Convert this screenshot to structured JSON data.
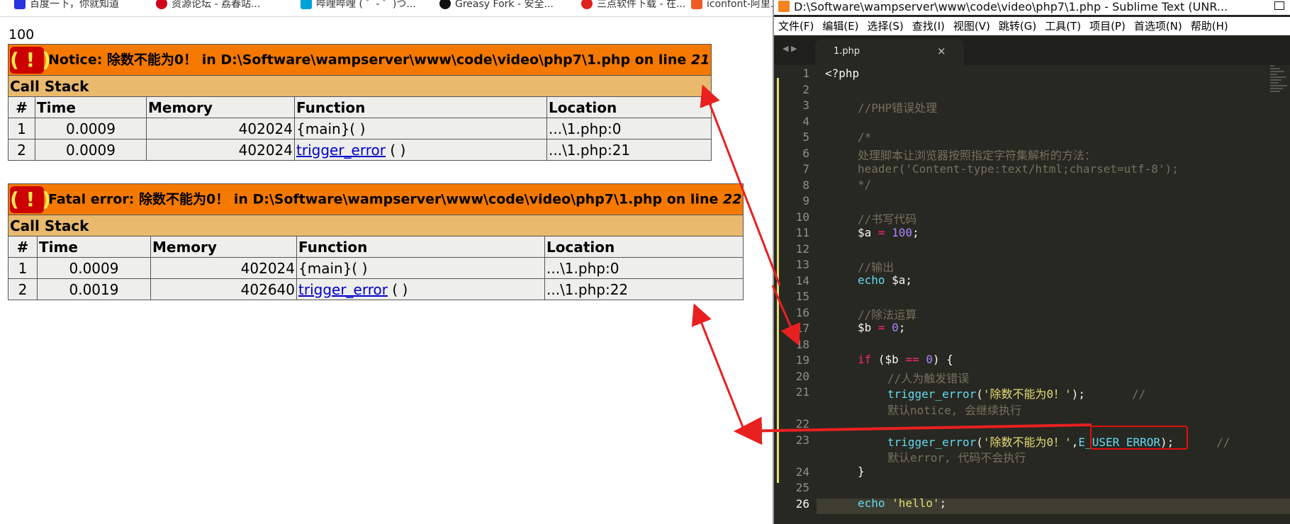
{
  "bookmarks": [
    {
      "label": "百度一下，你就知道",
      "color": "#2932e1"
    },
    {
      "label": "资源论坛 - 荔春站...",
      "color": "#d0021b"
    },
    {
      "label": "哔哩哔哩 ( ゜- ゜)つ...",
      "color": "#00a1d6"
    },
    {
      "label": "Greasy Fork - 安全...",
      "color": "#111111"
    },
    {
      "label": "三点软件下载 - 在...",
      "color": "#e0201c"
    },
    {
      "label": "iconfont-阿里...",
      "color": "#f05a28"
    }
  ],
  "browser": {
    "echo_output": "100"
  },
  "notice": {
    "icon": "( ! )",
    "label": "Notice: 除数不能为0！ in D:\\Software\\wampserver\\www\\code\\video\\php7\\1.php on line ",
    "line": "21",
    "call_stack_label": "Call Stack",
    "headers": [
      "#",
      "Time",
      "Memory",
      "Function",
      "Location"
    ],
    "rows": [
      {
        "num": "1",
        "time": "0.0009",
        "memory": "402024",
        "function": "{main}( )",
        "function_link": "",
        "location": "...\\1.php:0"
      },
      {
        "num": "2",
        "time": "0.0009",
        "memory": "402024",
        "function": " ( )",
        "function_link": "trigger_error",
        "location": "...\\1.php:21"
      }
    ]
  },
  "fatal": {
    "icon": "( ! )",
    "label": "Fatal error: 除数不能为0！ in D:\\Software\\wampserver\\www\\code\\video\\php7\\1.php on line ",
    "line": "22",
    "call_stack_label": "Call Stack",
    "headers": [
      "#",
      "Time",
      "Memory",
      "Function",
      "Location"
    ],
    "rows": [
      {
        "num": "1",
        "time": "0.0009",
        "memory": "402024",
        "function": "{main}( )",
        "function_link": "",
        "location": "...\\1.php:0"
      },
      {
        "num": "2",
        "time": "0.0019",
        "memory": "402640",
        "function": " ( )",
        "function_link": "trigger_error",
        "location": "...\\1.php:22"
      }
    ]
  },
  "editor": {
    "title": "D:\\Software\\wampserver\\www\\code\\video\\php7\\1.php - Sublime Text (UNR...",
    "menu": [
      "文件(F)",
      "编辑(E)",
      "选择(S)",
      "查找(I)",
      "视图(V)",
      "跳转(G)",
      "工具(T)",
      "项目(P)",
      "首选项(N)",
      "帮助(H)"
    ],
    "tab_label": "1.php",
    "tab_close": "×",
    "tab_nav": "◀ ▶",
    "line_numbers": [
      "1",
      "2",
      "3",
      "4",
      "5",
      "6",
      "7",
      "8",
      "9",
      "10",
      "11",
      "12",
      "13",
      "14",
      "15",
      "16",
      "17",
      "18",
      "19",
      "20",
      "21",
      "",
      "22",
      "23",
      "",
      "24",
      "25",
      "26"
    ],
    "code": {
      "l1": "<?php",
      "l3": "//PHP错误处理",
      "l5": "/*",
      "l6": "处理脚本让浏览器按照指定字符集解析的方法：",
      "l7": "header('Content-type:text/html;charset=utf-8');",
      "l8": "*/",
      "l10": "//书写代码",
      "l11_var": "$a",
      "l11_op": " = ",
      "l11_num": "100",
      "l11_end": ";",
      "l13": "//输出",
      "l14_kw": "echo",
      "l14_rest": " $a;",
      "l16": "//除法运算",
      "l17_var": "$b",
      "l17_op": " = ",
      "l17_num": "0",
      "l17_end": ";",
      "l19_kw": "if",
      "l19_a": " ($b ",
      "l19_op": "==",
      "l19_b": " ",
      "l19_num": "0",
      "l19_c": ") {",
      "l20": "//人为触发错误",
      "l21_fn": "trigger_error",
      "l21_a": "(",
      "l21_str": "'除数不能为0！'",
      "l21_b": ");",
      "l21_cm": "//",
      "l21_wrap": "默认notice, 会继续执行",
      "l23_fn": "trigger_error",
      "l23_a": "(",
      "l23_str": "'除数不能为0！'",
      "l23_b": ",",
      "l23_const": "E_USER_ERROR",
      "l23_c": ");",
      "l23_cm": "//",
      "l23_wrap": "默认error, 代码不会执行",
      "l24": "}",
      "l26_kw": "echo",
      "l26_sp": " ",
      "l26_str": "'hello'",
      "l26_end": ";"
    }
  },
  "colors": {
    "error_header": "#f57900",
    "call_stack_bg": "#e9b96e",
    "row_bg": "#eeeeec",
    "icon_bg": "#cc0000",
    "arrow": "#e82020",
    "editor_bg": "#272822"
  }
}
